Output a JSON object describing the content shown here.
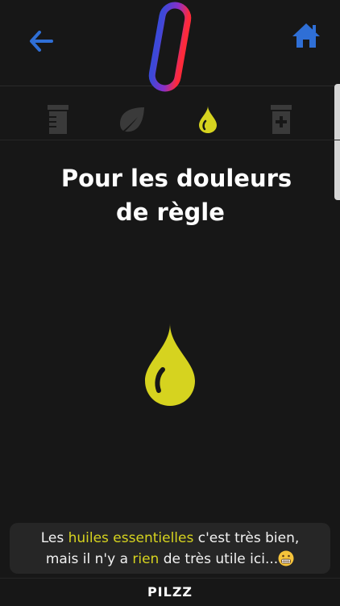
{
  "header": {
    "back_icon": "arrow-left-icon",
    "home_icon": "home-icon",
    "logo_icon": "pilzz-pill-logo",
    "accent_color": "#2f6fd6"
  },
  "tabs": [
    {
      "icon": "medicine-jar-icon",
      "active": false
    },
    {
      "icon": "leaf-icon",
      "active": false
    },
    {
      "icon": "drop-icon",
      "active": true
    },
    {
      "icon": "first-aid-bottle-icon",
      "active": false
    }
  ],
  "main": {
    "title_line1": "Pour les douleurs",
    "title_line2": "de règle",
    "illustration_icon": "oil-drop-icon",
    "highlight_color": "#d6d31f"
  },
  "message": {
    "part1": "Les ",
    "highlight1": "huiles essentielles",
    "part2": " c'est très bien,",
    "part3": "mais il n'y a ",
    "highlight2": "rien",
    "part4": " de très utile ici...",
    "emoji": "grimacing-face-emoji"
  },
  "footer": {
    "brand": "PILZZ"
  }
}
